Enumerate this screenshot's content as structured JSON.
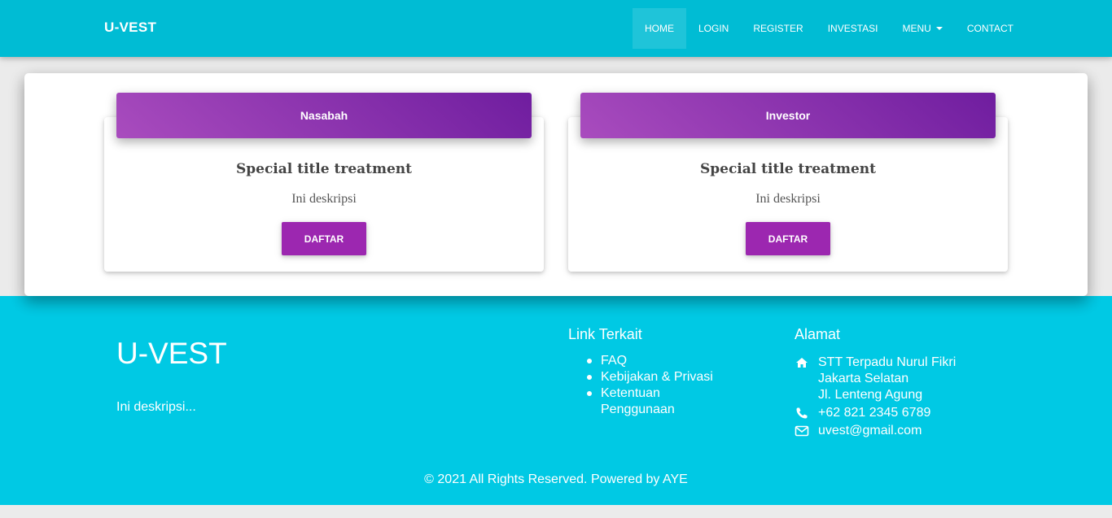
{
  "navbar": {
    "brand": "U-VEST",
    "items": [
      {
        "label": "HOME"
      },
      {
        "label": "LOGIN"
      },
      {
        "label": "REGISTER"
      },
      {
        "label": "INVESTASI"
      },
      {
        "label": "MENU"
      },
      {
        "label": "CONTACT"
      }
    ],
    "active": "HOME"
  },
  "cards": [
    {
      "header": "Nasabah",
      "title": "Special title treatment",
      "text": "Ini deskripsi",
      "button": "DAFTAR"
    },
    {
      "header": "Investor",
      "title": "Special title treatment",
      "text": "Ini deskripsi",
      "button": "DAFTAR"
    }
  ],
  "footer": {
    "brand": "U-VEST",
    "description": "Ini deskripsi...",
    "links_title": "Link Terkait",
    "links": [
      "FAQ",
      "Kebijakan & Privasi",
      "Ketentuan Penggunaan"
    ],
    "address_title": "Alamat",
    "address_lines": [
      "STT Terpadu Nurul Fikri",
      "Jakarta Selatan",
      "Jl. Lenteng Agung"
    ],
    "phone": "+62 821 2345 6789",
    "email": "uvest@gmail.com",
    "copyright": "© 2021 All Rights Reserved. Powered by AYE",
    "icons": {
      "address": "home-icon",
      "phone": "phone-icon",
      "email": "envelope-icon"
    }
  },
  "colors": {
    "primary": "#00bcd4",
    "footer": "#00c9e4",
    "accent": "#9c27b0",
    "gradient_start": "#a94cbe",
    "gradient_end": "#6f1d9f"
  }
}
